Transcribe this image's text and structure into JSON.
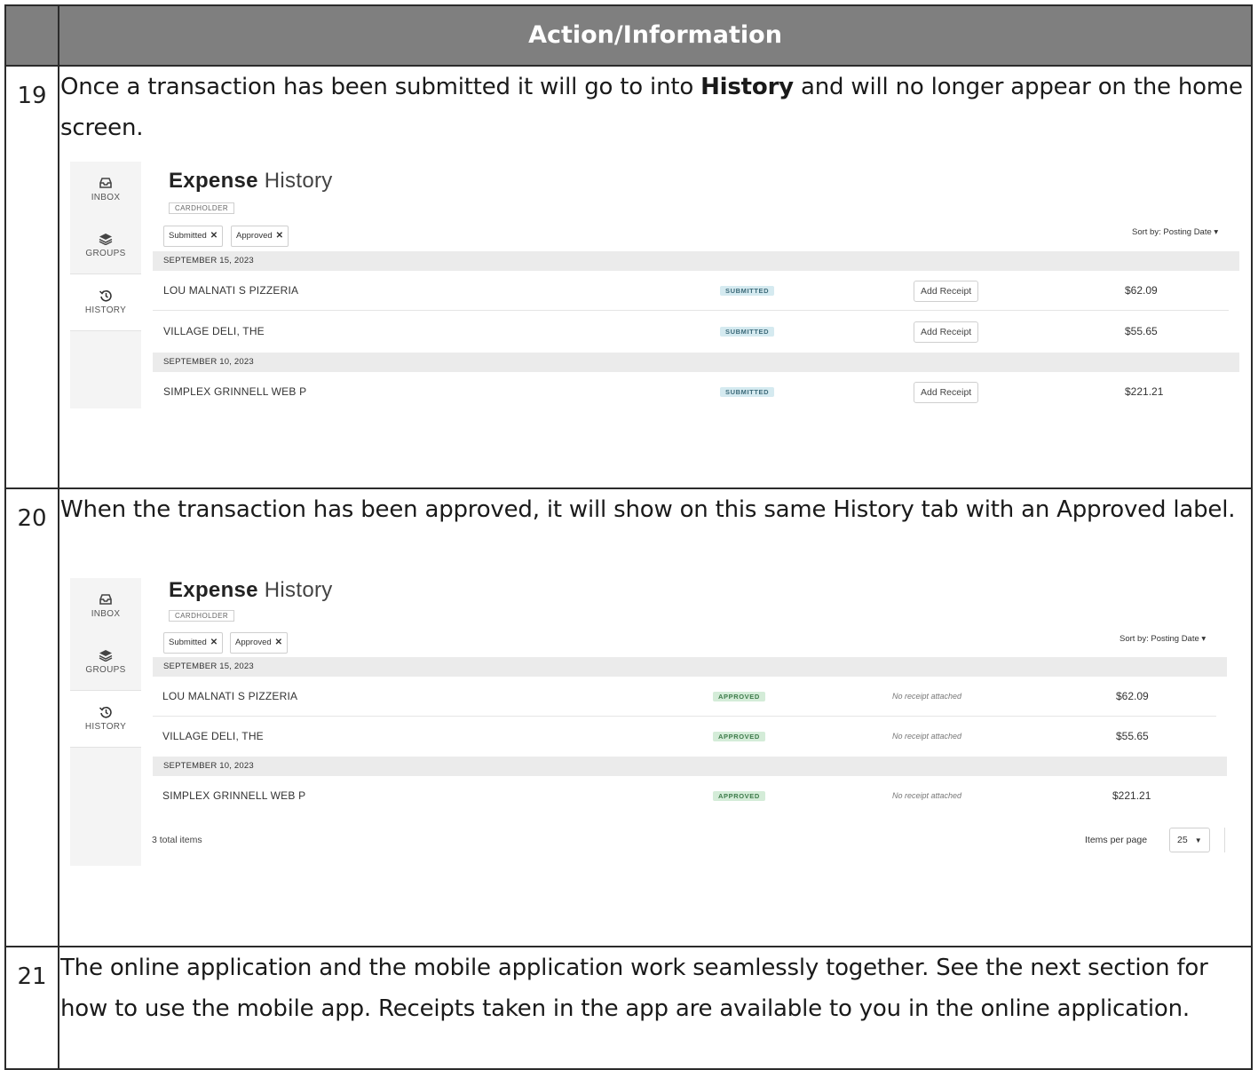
{
  "header": {
    "column_title": "Action/Information"
  },
  "rows": [
    {
      "num": "19",
      "text_before": "Once a transaction has been submitted it will go to into ",
      "text_bold": "History",
      "text_after": " and will no longer appear on the home screen.",
      "screenshot": {
        "title_bold": "Expense",
        "title_light": "History",
        "role": "CARDHOLDER",
        "filters": [
          "Submitted",
          "Approved"
        ],
        "remove_glyph": "✕",
        "sort_label": "Sort by: Posting Date ▾",
        "nav": [
          "INBOX",
          "GROUPS",
          "HISTORY"
        ],
        "groups": [
          {
            "date": "SEPTEMBER 15, 2023"
          },
          {
            "date": "SEPTEMBER 10, 2023"
          }
        ],
        "transactions": [
          {
            "merchant": "LOU MALNATI S PIZZERIA",
            "status": "SUBMITTED",
            "action": "Add Receipt",
            "amount": "$62.09"
          },
          {
            "merchant": "VILLAGE DELI, THE",
            "status": "SUBMITTED",
            "action": "Add Receipt",
            "amount": "$55.65"
          },
          {
            "merchant": "SIMPLEX GRINNELL WEB P",
            "status": "SUBMITTED",
            "action": "Add Receipt",
            "amount": "$221.21"
          }
        ]
      }
    },
    {
      "num": "20",
      "text": "When the transaction has been approved, it will show on this same History tab with an Approved label.",
      "screenshot": {
        "title_bold": "Expense",
        "title_light": "History",
        "role": "CARDHOLDER",
        "filters": [
          "Submitted",
          "Approved"
        ],
        "remove_glyph": "✕",
        "sort_label": "Sort by: Posting Date ▾",
        "nav": [
          "INBOX",
          "GROUPS",
          "HISTORY"
        ],
        "groups": [
          {
            "date": "SEPTEMBER 15, 2023"
          },
          {
            "date": "SEPTEMBER 10, 2023"
          }
        ],
        "transactions": [
          {
            "merchant": "LOU MALNATI S PIZZERIA",
            "status": "APPROVED",
            "receipt": "No receipt attached",
            "amount": "$62.09"
          },
          {
            "merchant": "VILLAGE DELI, THE",
            "status": "APPROVED",
            "receipt": "No receipt attached",
            "amount": "$55.65"
          },
          {
            "merchant": "SIMPLEX GRINNELL WEB P",
            "status": "APPROVED",
            "receipt": "No receipt attached",
            "amount": "$221.21"
          }
        ],
        "total_items": "3 total items",
        "items_per_page_label": "Items per page",
        "items_per_page_value": "25"
      }
    },
    {
      "num": "21",
      "text": "The online application and the mobile application work seamlessly together.  See the next section for how to use the mobile app.  Receipts taken in the app are available to you in the online application."
    }
  ]
}
